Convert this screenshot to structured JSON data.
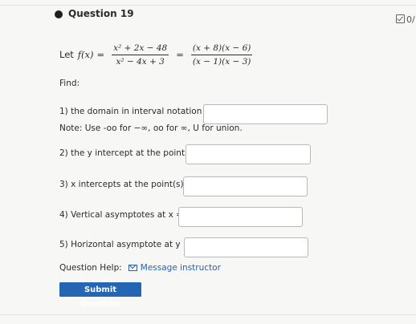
{
  "question": {
    "title": "Question 19",
    "score": "0/"
  },
  "function": {
    "let_prefix": "Let",
    "name": "f(x)",
    "equals": "=",
    "frac1_num": "x² + 2x − 48",
    "frac1_den": "x² − 4x + 3",
    "frac2_num": "(x + 8)(x − 6)",
    "frac2_den": "(x − 1)(x − 3)"
  },
  "find_label": "Find:",
  "parts": {
    "p1_label": "1) the domain in interval notation",
    "p1_note": "Note: Use -oo for −∞, oo for ∞, U for union.",
    "p2_label": "2) the y intercept at the point",
    "p3_label": "3) x intercepts at the point(s)",
    "p4_label": "4) Vertical asymptotes at x =",
    "p5_label": "5) Horizontal asymptote at y ="
  },
  "help": {
    "label": "Question Help:",
    "link": "Message instructor"
  },
  "submit_label": "Submit Question"
}
